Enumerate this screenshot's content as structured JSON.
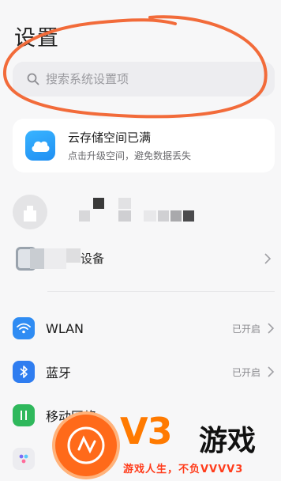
{
  "header": {
    "title": "设置"
  },
  "search": {
    "placeholder": "搜索系统设置项"
  },
  "cloud_card": {
    "title": "云存储空间已满",
    "subtitle": "点击升级空间，避免数据丢失",
    "icon": "cloud-icon"
  },
  "device_row": {
    "label_fragment": "设备"
  },
  "settings": [
    {
      "label": "WLAN",
      "status": "已开启",
      "icon": "wifi-icon",
      "color": "#2f8cf3"
    },
    {
      "label": "蓝牙",
      "status": "已开启",
      "icon": "bluetooth-icon",
      "color": "#2f7df0"
    },
    {
      "label": "移动网络",
      "status": "",
      "icon": "mobile-data-icon",
      "color": "#2fb85c"
    }
  ],
  "watermark": {
    "brand": "V3",
    "name": "游戏",
    "slogan": "游戏人生，不负VVVV3"
  },
  "colors": {
    "annotation_stroke": "#f26b3a",
    "cloud_accent": "#2a9df4",
    "background": "#f7f7f8"
  }
}
